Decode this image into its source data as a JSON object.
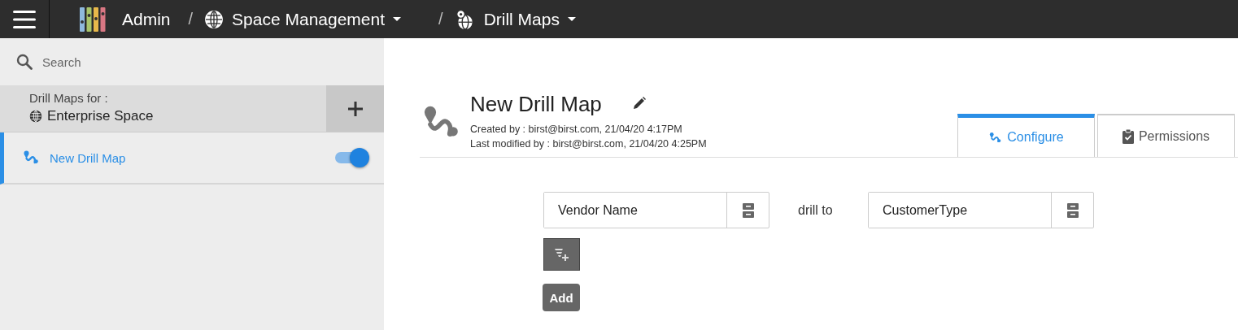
{
  "top_bar": {
    "app": "Admin",
    "breadcrumbs": [
      {
        "kind": "globe",
        "separator": "/",
        "label": "Space Management"
      },
      {
        "kind": "drill",
        "separator": "/",
        "label": "Drill Maps"
      }
    ]
  },
  "sidebar": {
    "search": {
      "placeholder": "Search"
    },
    "header": {
      "caption": "Drill Maps for :",
      "space": "Enterprise Space"
    },
    "items": [
      {
        "label": "New Drill Map",
        "selected": true,
        "on": true
      }
    ]
  },
  "detail": {
    "title": "New Drill Map",
    "created": "Created by : birst@birst.com, 21/04/20 4:17PM",
    "modified": "Last modified by : birst@birst.com, 21/04/20 4:25PM",
    "tabs": [
      {
        "kind": "drill",
        "label": "Configure",
        "selected": true
      },
      {
        "kind": "clipboard",
        "label": "Permissions",
        "selected": false
      }
    ],
    "mapping": {
      "source": "Vendor Name",
      "connector": "drill to",
      "target": "CustomerType"
    },
    "add_button": "Add"
  }
}
